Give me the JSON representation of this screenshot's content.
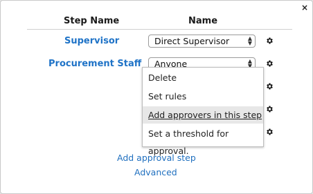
{
  "dialog": {
    "close_glyph": "×",
    "headers": {
      "step_name": "Step Name",
      "name": "Name"
    },
    "rows": [
      {
        "step_name": "Supervisor",
        "selected": "Direct Supervisor"
      },
      {
        "step_name": "Procurement Staff",
        "selected": "Anyone"
      }
    ],
    "context_menu": {
      "items": [
        "Delete",
        "Set rules",
        "Add approvers in this step",
        "Set a threshold for approval."
      ],
      "highlighted_index": 2
    },
    "links": {
      "add_step": "Add approval step",
      "advanced": "Advanced"
    },
    "colors": {
      "link": "#1f73c7",
      "menu_highlight": "#e7e7e7"
    }
  }
}
